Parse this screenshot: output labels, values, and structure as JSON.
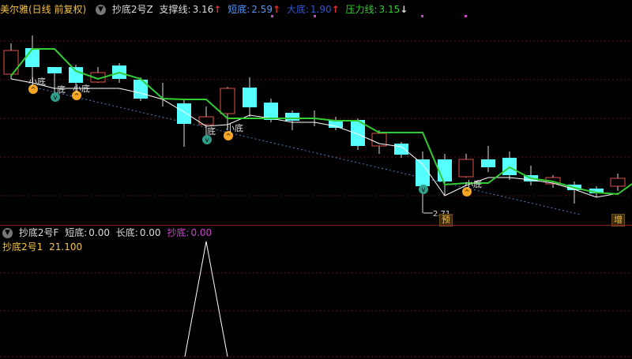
{
  "main_header": {
    "title": "美尔雅(日线 前复权)",
    "indicator_name": "抄底2号Z",
    "support_label": "支撑线:",
    "support_value": "3.16",
    "short_label": "短底:",
    "short_value": "2.59",
    "big_label": "大底:",
    "big_value": "1.90",
    "pressure_label": "压力线:",
    "pressure_value": "3.15"
  },
  "sub_header": {
    "indicator_name": "抄底2号F",
    "short_label": "短底:",
    "short_value": "0.00",
    "long_label": "长底:",
    "long_value": "0.00",
    "bottom_label": "抄底:",
    "bottom_value": "0.00",
    "line2_name": "抄底2号1",
    "line2_value": "21.100"
  },
  "annotations": {
    "small_bottom": "小底",
    "bottom_partial": "底",
    "low_price": "2.71",
    "badge_left": "预",
    "badge_right": "增"
  },
  "colors": {
    "up_candle": "#e0524b",
    "down_candle": "#55ffff",
    "pressure_line": "#33cc33",
    "support_line": "#ffffff",
    "trend_line": "#4a7fc0",
    "grid": "#8b1c1c",
    "magenta": "#cc44cc"
  }
}
